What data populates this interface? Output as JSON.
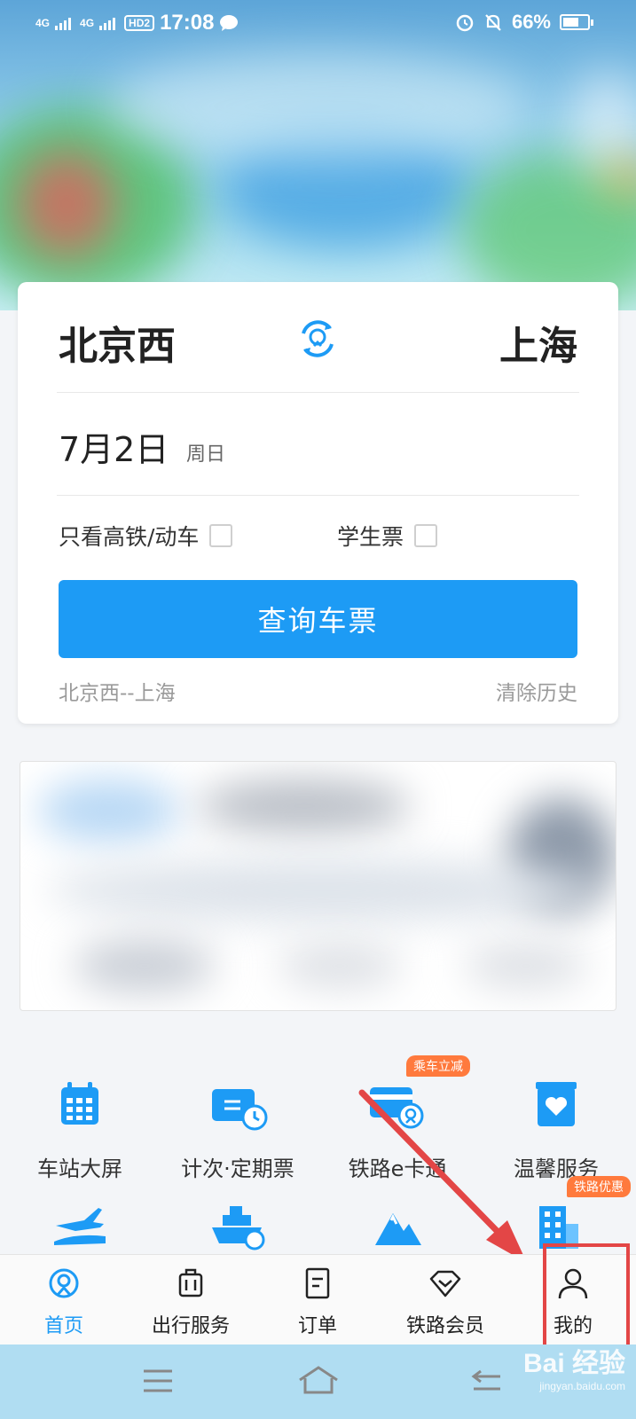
{
  "status_bar": {
    "network_1": "4G",
    "network_2": "4G",
    "hd": "HD",
    "hd_sub": "2",
    "time": "17:08",
    "battery": "66%",
    "battery_level": 0.66
  },
  "search_card": {
    "from_station": "北京西",
    "to_station": "上海",
    "date": "7月2日",
    "weekday": "周日",
    "option_high_speed": "只看高铁/动车",
    "option_student": "学生票",
    "query_button": "查询车票",
    "history_item": "北京西--上海",
    "clear_history": "清除历史"
  },
  "services": [
    {
      "label": "车站大屏",
      "icon": "calendar-icon"
    },
    {
      "label": "计次·定期票",
      "icon": "ticket-clock-icon"
    },
    {
      "label": "铁路e卡通",
      "icon": "railway-card-icon",
      "tag": "乘车立减"
    },
    {
      "label": "温馨服务",
      "icon": "heart-box-icon"
    }
  ],
  "services_row2": [
    {
      "icon": "plane-train-icon"
    },
    {
      "icon": "ship-icon"
    },
    {
      "icon": "mountain-icon"
    },
    {
      "icon": "building-icon",
      "tag": "铁路优惠"
    }
  ],
  "tab_bar": {
    "tabs": [
      {
        "label": "首页",
        "icon": "railway-logo-icon",
        "active": true
      },
      {
        "label": "出行服务",
        "icon": "luggage-icon"
      },
      {
        "label": "订单",
        "icon": "order-icon"
      },
      {
        "label": "铁路会员",
        "icon": "diamond-icon"
      },
      {
        "label": "我的",
        "icon": "user-icon"
      }
    ]
  },
  "colors": {
    "accent": "#1d9bf5",
    "highlight": "#e34646",
    "tag": "#ff7a3d"
  },
  "watermark": {
    "main": "Bai 经验",
    "sub": "jingyan.baidu.com"
  }
}
